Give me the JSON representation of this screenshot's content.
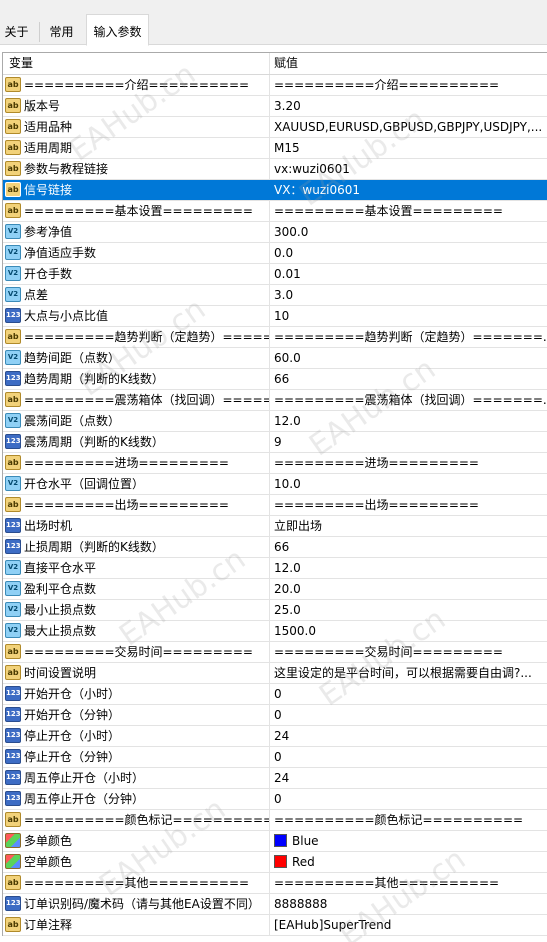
{
  "tabs": [
    "关于",
    "常用",
    "输入参数"
  ],
  "active_tab": 2,
  "columns": {
    "variable": "变量",
    "value": "赋值"
  },
  "selected_row": 5,
  "rows": [
    {
      "icon": "ab",
      "name": "==========介绍==========",
      "value": "==========介绍=========="
    },
    {
      "icon": "ab",
      "name": "版本号",
      "value": "3.20"
    },
    {
      "icon": "ab",
      "name": "适用品种",
      "value": "XAUUSD,EURUSD,GBPUSD,GBPJPY,USDJPY,..."
    },
    {
      "icon": "ab",
      "name": "适用周期",
      "value": "M15"
    },
    {
      "icon": "ab",
      "name": "参数与教程链接",
      "value": "vx:wuzi0601"
    },
    {
      "icon": "ab",
      "name": "信号链接",
      "value": "VX：wuzi0601"
    },
    {
      "icon": "ab",
      "name": "=========基本设置=========",
      "value": "=========基本设置========="
    },
    {
      "icon": "v2",
      "name": "参考净值",
      "value": "300.0"
    },
    {
      "icon": "v2",
      "name": "净值适应手数",
      "value": "0.0"
    },
    {
      "icon": "v2",
      "name": "开仓手数",
      "value": "0.01"
    },
    {
      "icon": "v2",
      "name": "点差",
      "value": "3.0"
    },
    {
      "icon": "123",
      "name": "大点与小点比值",
      "value": "10"
    },
    {
      "icon": "ab",
      "name": "=========趋势判断（定趋势）=====...",
      "value": "=========趋势判断（定趋势）=======..."
    },
    {
      "icon": "v2",
      "name": "趋势间距（点数）",
      "value": "60.0"
    },
    {
      "icon": "123",
      "name": "趋势周期（判断的K线数）",
      "value": "66"
    },
    {
      "icon": "ab",
      "name": "=========震荡箱体（找回调）=====...",
      "value": "=========震荡箱体（找回调）=======..."
    },
    {
      "icon": "v2",
      "name": "震荡间距（点数）",
      "value": "12.0"
    },
    {
      "icon": "123",
      "name": "震荡周期（判断的K线数）",
      "value": "9"
    },
    {
      "icon": "ab",
      "name": "=========进场=========",
      "value": "=========进场========="
    },
    {
      "icon": "v2",
      "name": "开仓水平（回调位置）",
      "value": "10.0"
    },
    {
      "icon": "ab",
      "name": "=========出场=========",
      "value": "=========出场========="
    },
    {
      "icon": "123",
      "name": "出场时机",
      "value": "立即出场"
    },
    {
      "icon": "123",
      "name": "止损周期（判断的K线数）",
      "value": "66"
    },
    {
      "icon": "v2",
      "name": "直接平仓水平",
      "value": "12.0"
    },
    {
      "icon": "v2",
      "name": "盈利平仓点数",
      "value": "20.0"
    },
    {
      "icon": "v2",
      "name": "最小止损点数",
      "value": "25.0"
    },
    {
      "icon": "v2",
      "name": "最大止损点数",
      "value": "1500.0"
    },
    {
      "icon": "ab",
      "name": "=========交易时间=========",
      "value": "=========交易时间========="
    },
    {
      "icon": "ab",
      "name": "时间设置说明",
      "value": "这里设定的是平台时间，可以根据需要自由调?..."
    },
    {
      "icon": "123",
      "name": "开始开仓（小时）",
      "value": "0"
    },
    {
      "icon": "123",
      "name": "开始开仓（分钟）",
      "value": "0"
    },
    {
      "icon": "123",
      "name": "停止开仓（小时）",
      "value": "24"
    },
    {
      "icon": "123",
      "name": "停止开仓（分钟）",
      "value": "0"
    },
    {
      "icon": "123",
      "name": "周五停止开仓（小时）",
      "value": "24"
    },
    {
      "icon": "123",
      "name": "周五停止开仓（分钟）",
      "value": "0"
    },
    {
      "icon": "ab",
      "name": "==========颜色标记==========",
      "value": "==========颜色标记=========="
    },
    {
      "icon": "clr",
      "name": "多单颜色",
      "value": "Blue",
      "swatch": "#0000ff"
    },
    {
      "icon": "clr",
      "name": "空单颜色",
      "value": "Red",
      "swatch": "#ff0000"
    },
    {
      "icon": "ab",
      "name": "==========其他==========",
      "value": "==========其他=========="
    },
    {
      "icon": "123",
      "name": "订单识别码/魔术码（请与其他EA设置不同）",
      "value": "8888888"
    },
    {
      "icon": "ab",
      "name": "订单注释",
      "value": "[EAHub]SuperTrend"
    }
  ],
  "watermark": "EAHub.cn",
  "colors": {
    "selection": "#0078d7",
    "blue": "#0000ff",
    "red": "#ff0000"
  }
}
